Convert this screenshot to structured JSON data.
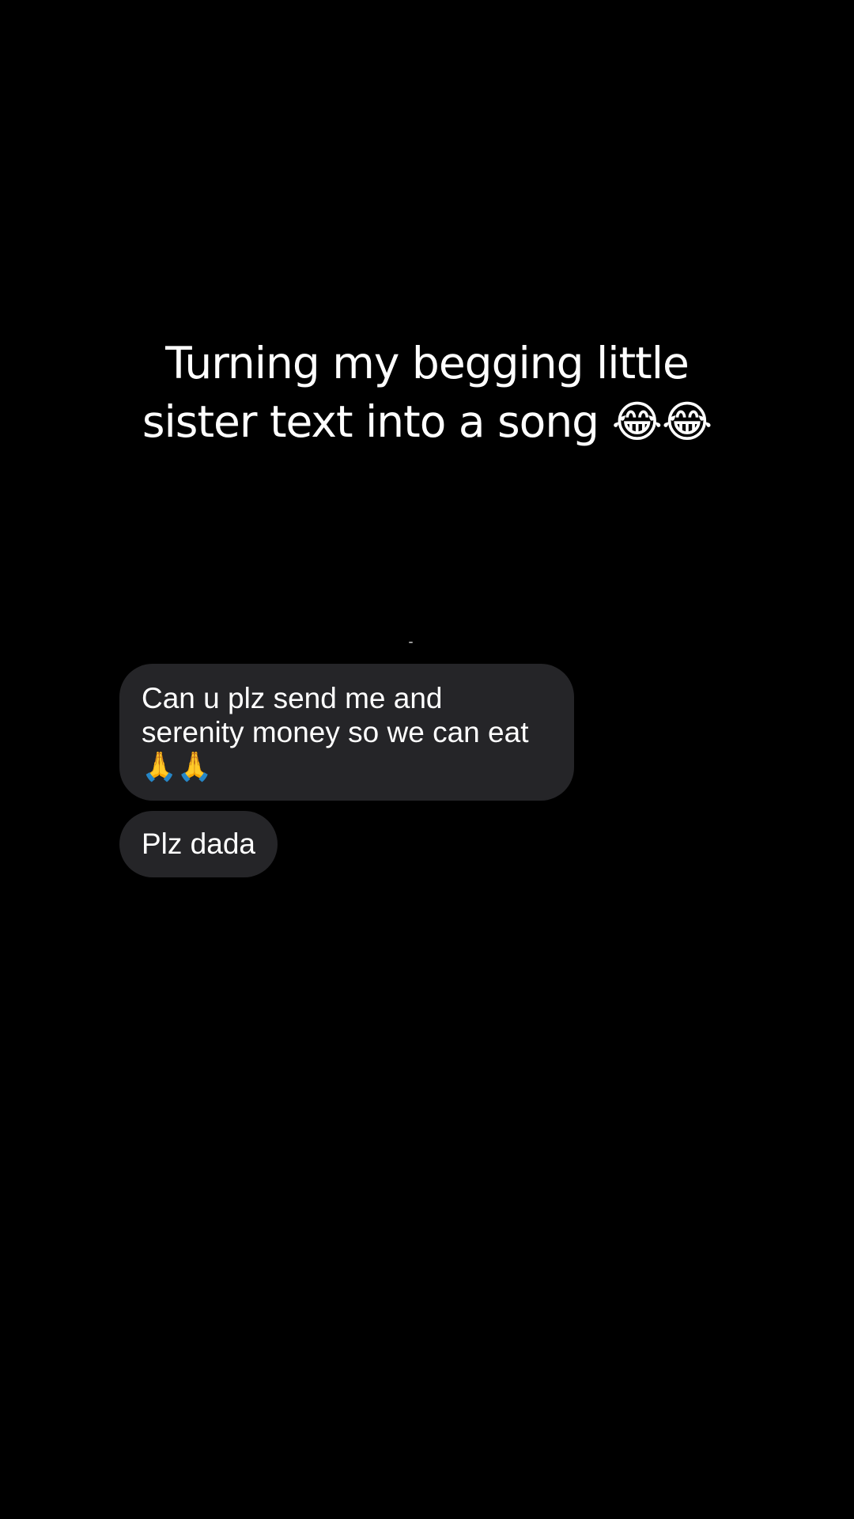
{
  "caption": {
    "line1": "Turning my begging little",
    "line2": "sister text into a song 😂😂"
  },
  "messages": [
    {
      "lines": [
        "Can u plz send me and",
        "serenity money so we can eat",
        "🙏🙏"
      ]
    },
    {
      "lines": [
        "Plz dada"
      ]
    }
  ],
  "colors": {
    "background": "#000000",
    "bubble": "#252528",
    "text": "#ffffff"
  }
}
